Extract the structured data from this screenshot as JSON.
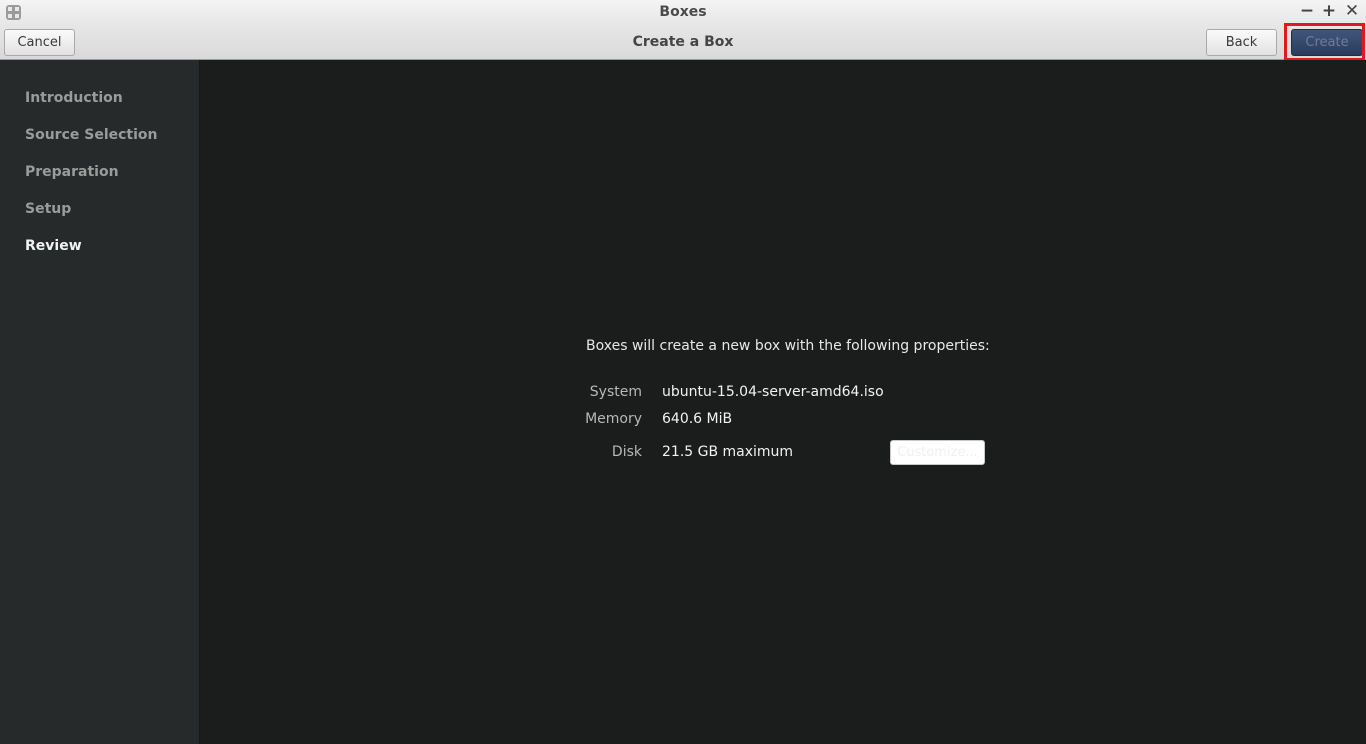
{
  "window": {
    "app_title": "Boxes",
    "controls": {
      "minimize": "−",
      "maximize": "+",
      "close": "✕"
    }
  },
  "header": {
    "title": "Create a Box",
    "cancel_label": "Cancel",
    "back_label": "Back",
    "create_label": "Create"
  },
  "sidebar": {
    "items": [
      {
        "label": "Introduction",
        "active": false
      },
      {
        "label": "Source Selection",
        "active": false
      },
      {
        "label": "Preparation",
        "active": false
      },
      {
        "label": "Setup",
        "active": false
      },
      {
        "label": "Review",
        "active": true
      }
    ]
  },
  "review": {
    "summary": "Boxes will create a new box with the following properties:",
    "properties": [
      {
        "label": "System",
        "value": "ubuntu-15.04-server-amd64.iso"
      },
      {
        "label": "Memory",
        "value": "640.6 MiB"
      },
      {
        "label": "Disk",
        "value": "21.5 GB maximum"
      }
    ],
    "customize_label": "Customize..."
  },
  "annotation": {
    "highlight_color": "#e3171f",
    "target": "create-button"
  },
  "colors": {
    "background": "#1b1c1c",
    "sidebar": "#272a2a",
    "create_button": "#2f4466"
  },
  "icons": [
    "boxes-app-icon",
    "minimize-icon",
    "maximize-icon",
    "close-icon",
    "red-arrow-icon"
  ]
}
